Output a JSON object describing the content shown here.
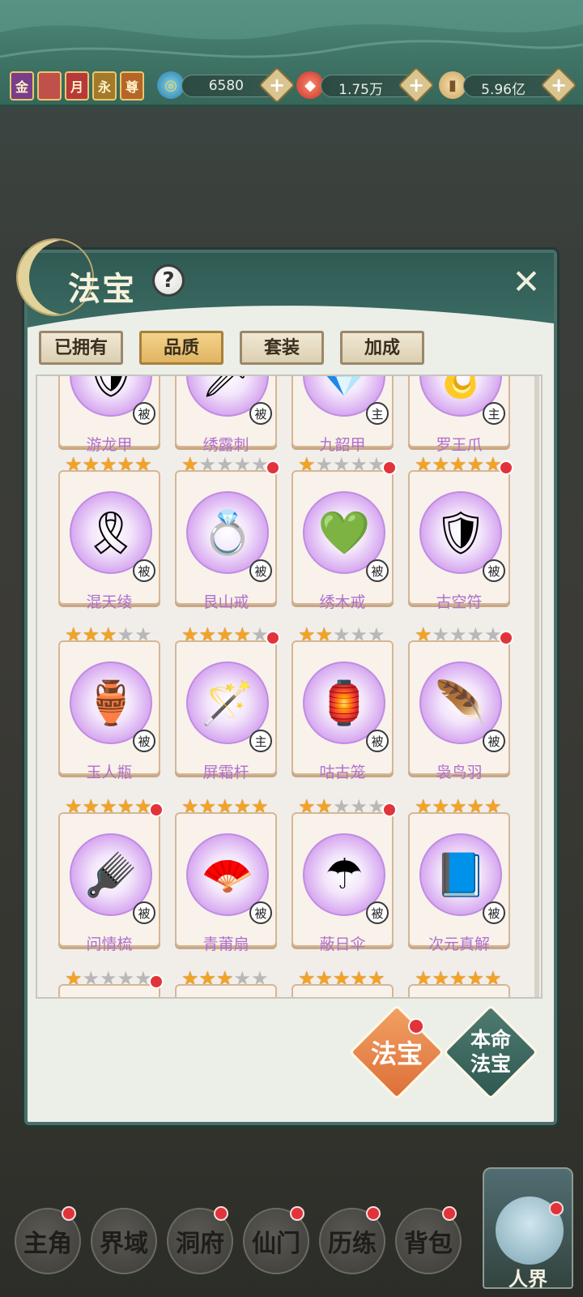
{
  "topbar": {
    "badges": [
      {
        "icon": "gold-badge-icon",
        "text": "金",
        "color": "#7a3d8a"
      },
      {
        "icon": "shield-badge-icon",
        "text": "",
        "color": "#c0504a"
      },
      {
        "icon": "month-badge-icon",
        "text": "月",
        "color": "#b8393a"
      },
      {
        "icon": "forever-badge-icon",
        "text": "永",
        "color": "#a37a2c"
      },
      {
        "icon": "honor-badge-icon",
        "text": "尊",
        "color": "#b5652a"
      }
    ],
    "resources": [
      {
        "icon": "spirit-swirl-icon",
        "value": "6580"
      },
      {
        "icon": "red-crystal-icon",
        "value": "1.75万"
      },
      {
        "icon": "scroll-icon",
        "value": "5.96亿"
      }
    ]
  },
  "panel": {
    "title": "法宝",
    "help": "?",
    "close": "✕",
    "tabs": [
      "已拥有",
      "品质",
      "套装",
      "加成"
    ],
    "active_tab": 1
  },
  "items": [
    {
      "name": "游龙甲",
      "stars": 0,
      "tag": "被",
      "dot": false,
      "icon": "armor-icon",
      "glyph": "🛡"
    },
    {
      "name": "绣露刺",
      "stars": 0,
      "tag": "被",
      "dot": false,
      "icon": "thorn-icon",
      "glyph": "🗡"
    },
    {
      "name": "九韶甲",
      "stars": 0,
      "tag": "主",
      "dot": false,
      "icon": "armor-icon",
      "glyph": "💎"
    },
    {
      "name": "罗王爪",
      "stars": 0,
      "tag": "主",
      "dot": false,
      "icon": "claw-icon",
      "glyph": "🪝"
    },
    {
      "name": "混天绫",
      "stars": 5,
      "tag": "被",
      "dot": false,
      "icon": "silk-ribbon-icon",
      "glyph": "🎗"
    },
    {
      "name": "艮山戒",
      "stars": 1,
      "tag": "被",
      "dot": true,
      "icon": "ring-icon",
      "glyph": "💍"
    },
    {
      "name": "绣木戒",
      "stars": 1,
      "tag": "被",
      "dot": true,
      "icon": "ring-icon",
      "glyph": "💚"
    },
    {
      "name": "古空符",
      "stars": 5,
      "tag": "被",
      "dot": true,
      "icon": "talisman-icon",
      "glyph": "🛡"
    },
    {
      "name": "玉人瓶",
      "stars": 3,
      "tag": "被",
      "dot": false,
      "icon": "bottle-icon",
      "glyph": "🏺"
    },
    {
      "name": "屏霜杆",
      "stars": 4,
      "tag": "主",
      "dot": true,
      "icon": "whip-icon",
      "glyph": "🪄"
    },
    {
      "name": "咕古笼",
      "stars": 2,
      "tag": "被",
      "dot": false,
      "icon": "birdcage-icon",
      "glyph": "🏮"
    },
    {
      "name": "袅鸟羽",
      "stars": 1,
      "tag": "被",
      "dot": true,
      "icon": "feather-icon",
      "glyph": "🪶"
    },
    {
      "name": "问情梳",
      "stars": 5,
      "tag": "被",
      "dot": true,
      "icon": "comb-icon",
      "glyph": "🪮"
    },
    {
      "name": "青莆扇",
      "stars": 5,
      "tag": "被",
      "dot": false,
      "icon": "fan-icon",
      "glyph": "🪭"
    },
    {
      "name": "蔽日伞",
      "stars": 2,
      "tag": "被",
      "dot": true,
      "icon": "umbrella-icon",
      "glyph": "☂"
    },
    {
      "name": "次元真解",
      "stars": 5,
      "tag": "被",
      "dot": false,
      "icon": "book-icon",
      "glyph": "📘"
    },
    {
      "name": "",
      "stars": 1,
      "tag": "",
      "dot": true,
      "icon": "",
      "glyph": ""
    },
    {
      "name": "",
      "stars": 3,
      "tag": "",
      "dot": false,
      "icon": "",
      "glyph": ""
    },
    {
      "name": "",
      "stars": 5,
      "tag": "",
      "dot": false,
      "icon": "",
      "glyph": ""
    },
    {
      "name": "",
      "stars": 5,
      "tag": "",
      "dot": false,
      "icon": "",
      "glyph": ""
    }
  ],
  "actions": {
    "fabao": "法宝",
    "benming": "本命\n法宝"
  },
  "nav": [
    {
      "label": "主角",
      "dot": true
    },
    {
      "label": "界域",
      "dot": false
    },
    {
      "label": "洞府",
      "dot": true
    },
    {
      "label": "仙门",
      "dot": true
    },
    {
      "label": "历练",
      "dot": true
    },
    {
      "label": "背包",
      "dot": true
    }
  ],
  "world": {
    "label": "人界",
    "dot": true
  }
}
